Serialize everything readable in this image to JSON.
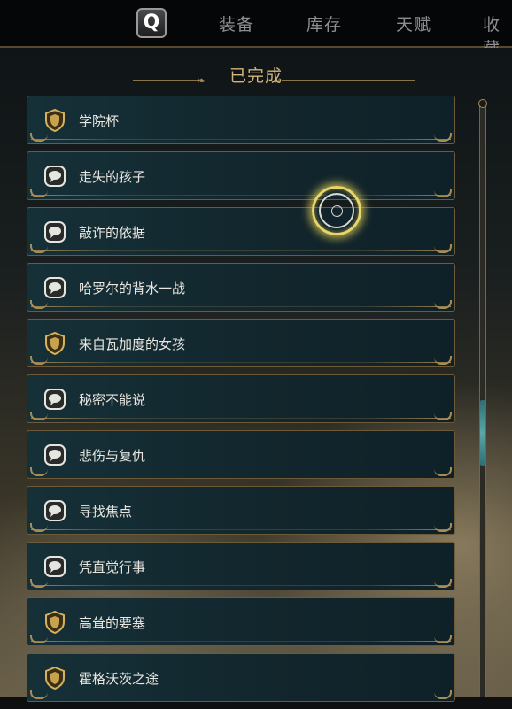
{
  "top_bar": {
    "key_hint": "Q",
    "tabs": [
      {
        "label": "装备"
      },
      {
        "label": "库存"
      },
      {
        "label": "天赋"
      },
      {
        "label": "收藏"
      }
    ]
  },
  "section": {
    "title": "已完成"
  },
  "quests": [
    {
      "label": "学院杯",
      "icon": "shield-quest-icon"
    },
    {
      "label": "走失的孩子",
      "icon": "speech-bubble-quest-icon"
    },
    {
      "label": "敲诈的依据",
      "icon": "speech-bubble-quest-icon"
    },
    {
      "label": "哈罗尔的背水一战",
      "icon": "speech-bubble-quest-icon"
    },
    {
      "label": "来自瓦加度的女孩",
      "icon": "shield-quest-icon"
    },
    {
      "label": "秘密不能说",
      "icon": "speech-bubble-quest-icon"
    },
    {
      "label": "悲伤与复仇",
      "icon": "speech-bubble-quest-icon"
    },
    {
      "label": "寻找焦点",
      "icon": "speech-bubble-quest-icon"
    },
    {
      "label": "凭直觉行事",
      "icon": "speech-bubble-quest-icon"
    },
    {
      "label": "高耸的要塞",
      "icon": "shield-quest-icon"
    },
    {
      "label": "霍格沃茨之途",
      "icon": "shield-quest-icon"
    }
  ],
  "colors": {
    "accent_gold": "#a88c56",
    "title_gold": "#d2b57a",
    "row_bg": "#163038",
    "scroll_thumb": "#5aa7a8"
  }
}
